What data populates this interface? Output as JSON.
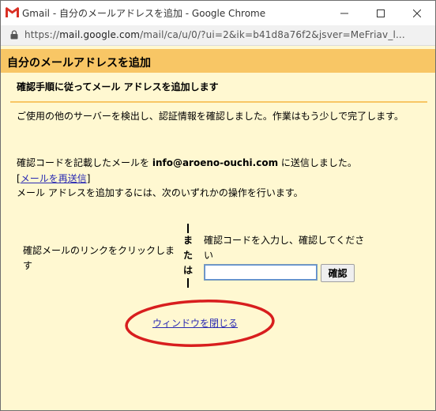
{
  "window": {
    "title": "Gmail - 自分のメールアドレスを追加 - Google Chrome",
    "url_scheme": "https://",
    "url_host": "mail.google.com",
    "url_path": "/mail/ca/u/0/?ui=2&ik=b41d8a76f2&jsver=MeFriav_l..."
  },
  "dialog": {
    "header": "自分のメールアドレスを追加",
    "subtitle": "確認手順に従ってメール アドレスを追加します",
    "paragraph1": "ご使用の他のサーバーを検出し、認証情報を確認しました。作業はもう少しで完了します。",
    "code_sent_prefix": "確認コードを記載したメールを ",
    "email": "info@aroeno-ouchi.com",
    "code_sent_suffix": " に送信しました。",
    "resend_bracket_open": "[",
    "resend_link": "メールを再送信",
    "resend_bracket_close": "]",
    "instruction": "メール アドレスを追加するには、次のいずれかの操作を行います。",
    "option1": "確認メールのリンクをクリックします",
    "or_chars": [
      "ま",
      "た",
      "は"
    ],
    "option2": "確認コードを入力し、確認してください",
    "code_input_value": "",
    "confirm_button": "確認",
    "close_window_link": "ウィンドウを閉じる"
  },
  "colors": {
    "header_band": "#f8c665",
    "content_bg": "#fff8d1",
    "annotation_ellipse": "#d81e1e",
    "link": "#2a2ab3"
  }
}
